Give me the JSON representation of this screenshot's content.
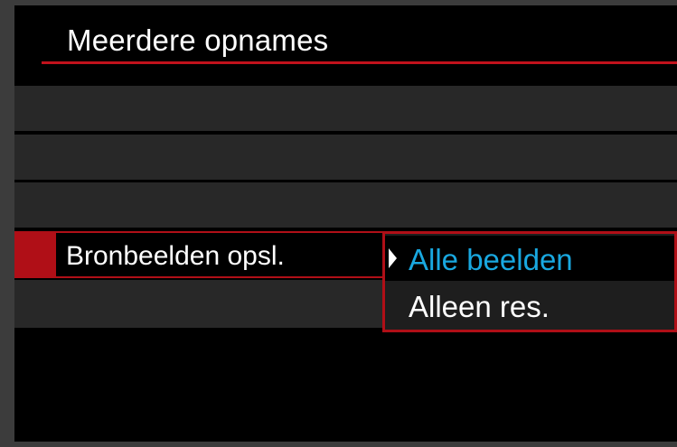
{
  "screen": {
    "title": "Meerdere opnames",
    "setting": {
      "label": "Bronbeelden opsl."
    },
    "options": [
      {
        "label": "Alle beelden",
        "selected": true,
        "icon": "selection-arrow-icon"
      },
      {
        "label": "Alleen res.",
        "selected": false
      }
    ]
  },
  "colors": {
    "accent_red": "#b00f17",
    "selected_text": "#19a8e0",
    "background": "#000000"
  }
}
